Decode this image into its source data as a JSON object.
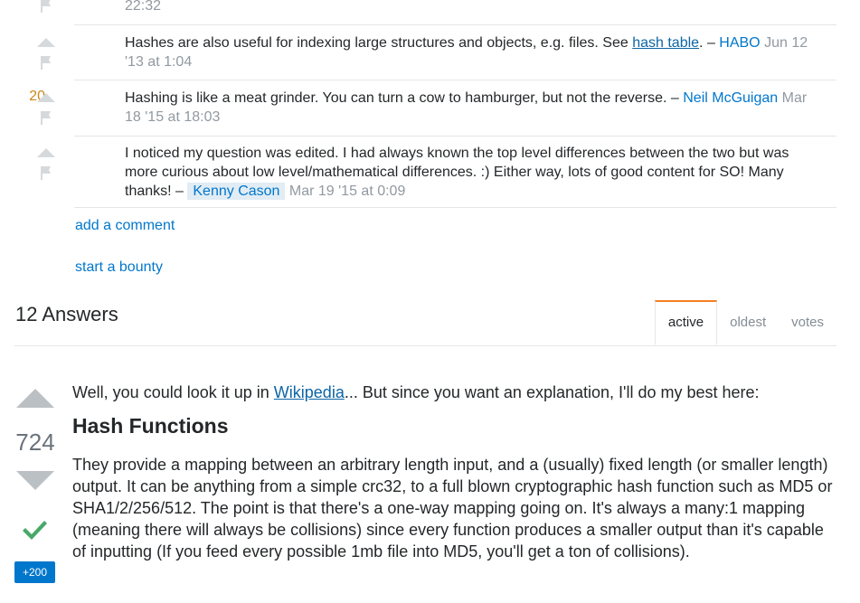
{
  "comments": [
    {
      "time_fragment": "22:32"
    },
    {
      "score": "",
      "text": "Hashes are also useful for indexing large structures and objects, e.g. files. See ",
      "link": "hash table",
      "after_link": ". – ",
      "user": "HABO",
      "date": " Jun 12 '13 at 1:04"
    },
    {
      "score": "20",
      "text": "Hashing is like a meat grinder. You can turn a cow to hamburger, but not the reverse. – ",
      "user": "Neil McGuigan",
      "date": " Mar 18 '15 at 18:03"
    },
    {
      "score": "",
      "text": "I noticed my question was edited. I had always known the top level differences between the two but was more curious about low level/mathematical differences. :) Either way, lots of good content for SO! Many thanks! – ",
      "user": "Kenny Cason",
      "date": " Mar 19 '15 at 0:09"
    }
  ],
  "add_comment": "add a comment",
  "start_bounty": "start a bounty",
  "answers": {
    "count_label": "12 Answers",
    "tabs": [
      "active",
      "oldest",
      "votes"
    ],
    "active_tab": "active"
  },
  "answer": {
    "score": "724",
    "bounty": "+200",
    "accepted": true,
    "intro_before": "Well, you could look it up in ",
    "intro_link": "Wikipedia",
    "intro_after": "... But since you want an explanation, I'll do my best here:",
    "heading": "Hash Functions",
    "para": "They provide a mapping between an arbitrary length input, and a (usually) fixed length (or smaller length) output. It can be anything from a simple crc32, to a full blown cryptographic hash function such as MD5 or SHA1/2/256/512. The point is that there's a one-way mapping going on. It's always a many:1 mapping (meaning there will always be collisions) since every function produces a smaller output than it's capable of inputting (If you feed every possible 1mb file into MD5, you'll get a ton of collisions)."
  },
  "colors": {
    "link": "#0077cc",
    "accepted": "#48a868",
    "bounty": "#0077cc",
    "active_tab": "#f48024",
    "score_highlight": "#c9861e"
  }
}
